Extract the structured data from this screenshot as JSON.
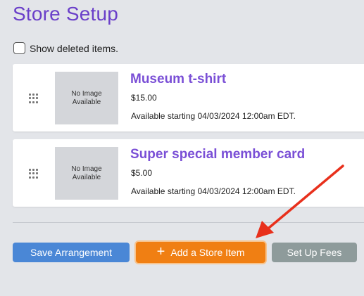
{
  "page": {
    "title": "Store Setup"
  },
  "filters": {
    "show_deleted_label": "Show deleted items.",
    "show_deleted_checked": false
  },
  "items": [
    {
      "thumbnail_text": "No Image Available",
      "name": "Museum t-shirt",
      "price": "$15.00",
      "availability": "Available starting 04/03/2024 12:00am EDT."
    },
    {
      "thumbnail_text": "No Image Available",
      "name": "Super special member card",
      "price": "$5.00",
      "availability": "Available starting 04/03/2024 12:00am EDT."
    }
  ],
  "actions": {
    "save_label": "Save Arrangement",
    "add_label": "Add a Store Item",
    "add_icon": "plus-icon",
    "fees_label": "Set Up Fees"
  },
  "colors": {
    "title": "#6a3fc9",
    "item_name": "#7a4fd6",
    "save_button": "#4a87d6",
    "add_button": "#f07f13",
    "fees_button": "#8e9b9b",
    "annotation_arrow": "#e8301c"
  }
}
